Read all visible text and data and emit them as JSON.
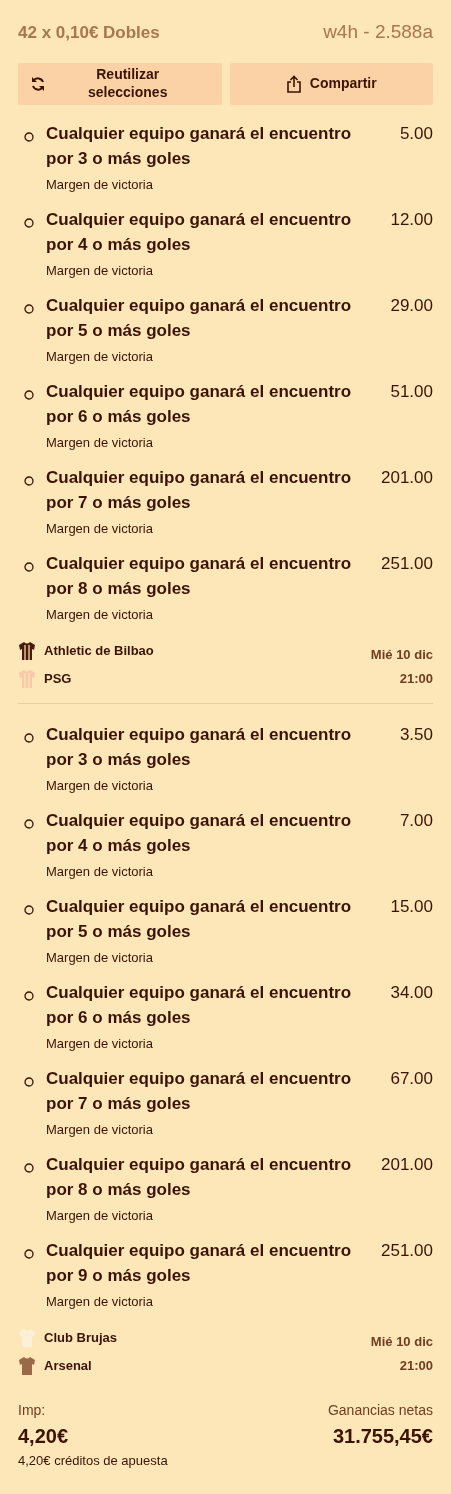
{
  "header": {
    "title": "42 x 0,10€ Dobles",
    "reference": "w4h - 2.588a"
  },
  "buttons": [
    {
      "kind": "reuse",
      "label": "Reutilizar selecciones"
    },
    {
      "kind": "share",
      "label": "Compartir"
    }
  ],
  "events": [
    {
      "selections": [
        {
          "title": "Cualquier equipo ganará el encuentro por 3 o más goles",
          "odds": "5.00",
          "market": "Margen de victoria"
        },
        {
          "title": "Cualquier equipo ganará el encuentro por 4 o más goles",
          "odds": "12.00",
          "market": "Margen de victoria"
        },
        {
          "title": "Cualquier equipo ganará el encuentro por 5 o más goles",
          "odds": "29.00",
          "market": "Margen de victoria"
        },
        {
          "title": "Cualquier equipo ganará el encuentro por 6 o más goles",
          "odds": "51.00",
          "market": "Margen de victoria"
        },
        {
          "title": "Cualquier equipo ganará el encuentro por 7 o más goles",
          "odds": "201.00",
          "market": "Margen de victoria"
        },
        {
          "title": "Cualquier equipo ganará el encuentro por 8 o más goles",
          "odds": "251.00",
          "market": "Margen de victoria"
        }
      ],
      "teams": [
        {
          "name": "Athletic de Bilbao",
          "color": "#4a1c0c"
        },
        {
          "name": "PSG",
          "color": "#f6c9a8"
        }
      ],
      "date": "Mié 10 dic",
      "time": "21:00"
    },
    {
      "selections": [
        {
          "title": "Cualquier equipo ganará el encuentro por 3 o más goles",
          "odds": "3.50",
          "market": "Margen de victoria"
        },
        {
          "title": "Cualquier equipo ganará el encuentro por 4 o más goles",
          "odds": "7.00",
          "market": "Margen de victoria"
        },
        {
          "title": "Cualquier equipo ganará el encuentro por 5 o más goles",
          "odds": "15.00",
          "market": "Margen de victoria"
        },
        {
          "title": "Cualquier equipo ganará el encuentro por 6 o más goles",
          "odds": "34.00",
          "market": "Margen de victoria"
        },
        {
          "title": "Cualquier equipo ganará el encuentro por 7 o más goles",
          "odds": "67.00",
          "market": "Margen de victoria"
        },
        {
          "title": "Cualquier equipo ganará el encuentro por 8 o más goles",
          "odds": "201.00",
          "market": "Margen de victoria"
        },
        {
          "title": "Cualquier equipo ganará el encuentro por 9 o más goles",
          "odds": "251.00",
          "market": "Margen de victoria"
        }
      ],
      "teams": [
        {
          "name": "Club Brujas",
          "color": "#fdf0d8"
        },
        {
          "name": "Arsenal",
          "color": "#9a6a48"
        }
      ],
      "date": "Mié 10 dic",
      "time": "21:00"
    }
  ],
  "footer": {
    "stake_label": "Imp:",
    "stake": "4,20€",
    "credits": "4,20€ créditos de apuesta",
    "winnings_label": "Ganancias netas",
    "winnings": "31.755,45€"
  }
}
